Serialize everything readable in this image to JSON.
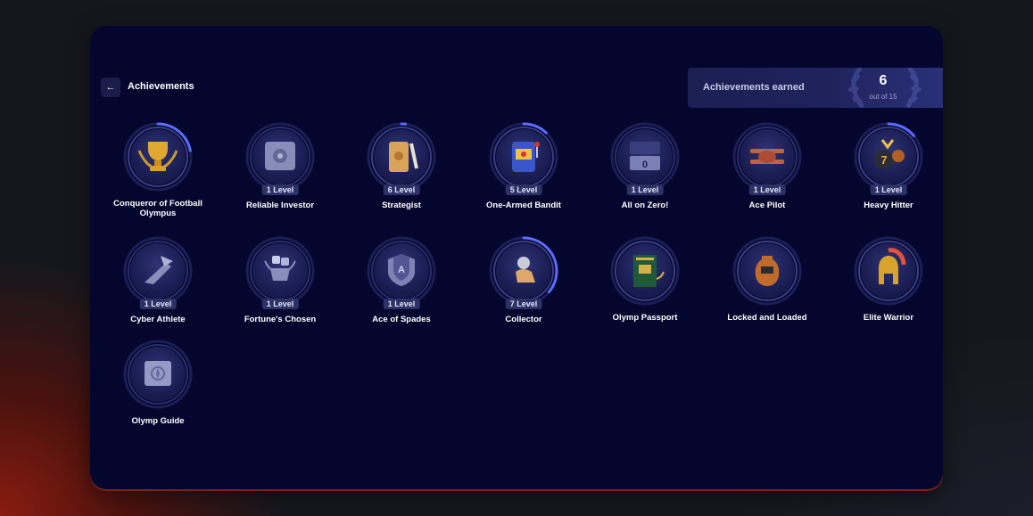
{
  "header": {
    "back_icon": "arrow-left-icon",
    "title": "Achievements"
  },
  "summary": {
    "label": "Achievements earned",
    "count": "6",
    "total": "out of 15",
    "decoration_icon": "laurel-wreath-icon"
  },
  "colors": {
    "panel": "#05062e",
    "progress_ring": "#5c6cff",
    "ring_track": "#1c1f55",
    "level_badge": "#2c3166"
  },
  "achievements": [
    {
      "name": "Conqueror of Football Olympus",
      "level": "",
      "progress": 0.22,
      "icon": "trophy-cup-icon",
      "earned": true
    },
    {
      "name": "Reliable Investor",
      "level": "1 Level",
      "progress": 0.0,
      "icon": "safe-icon",
      "earned": false
    },
    {
      "name": "Strategist",
      "level": "6 Level",
      "progress": 0.02,
      "icon": "scroll-quill-icon",
      "earned": true
    },
    {
      "name": "One-Armed Bandit",
      "level": "5 Level",
      "progress": 0.12,
      "icon": "slot-machine-icon",
      "earned": true
    },
    {
      "name": "All on Zero!",
      "level": "1 Level",
      "progress": 0.0,
      "icon": "calendar-zero-icon",
      "earned": false
    },
    {
      "name": "Ace Pilot",
      "level": "1 Level",
      "progress": 0.0,
      "icon": "biplane-icon",
      "earned": false
    },
    {
      "name": "Heavy Hitter",
      "level": "1 Level",
      "progress": 0.14,
      "icon": "seven-ball-icon",
      "earned": true
    },
    {
      "name": "Cyber Athlete",
      "level": "1 Level",
      "progress": 0.0,
      "icon": "winged-sandal-icon",
      "earned": false
    },
    {
      "name": "Fortune's Chosen",
      "level": "1 Level",
      "progress": 0.0,
      "icon": "cup-dice-icon",
      "earned": false
    },
    {
      "name": "Ace of Spades",
      "level": "1 Level",
      "progress": 0.0,
      "icon": "spade-shield-icon",
      "earned": false
    },
    {
      "name": "Collector",
      "level": "7 Level",
      "progress": 0.36,
      "icon": "hand-coin-icon",
      "earned": true
    },
    {
      "name": "Olymp Passport",
      "level": "",
      "progress": 0.0,
      "icon": "passport-icon",
      "earned": true
    },
    {
      "name": "Locked and Loaded",
      "level": "",
      "progress": 0.0,
      "icon": "amphora-icon",
      "earned": true
    },
    {
      "name": "Elite Warrior",
      "level": "",
      "progress": 0.0,
      "icon": "spartan-helmet-icon",
      "earned": true
    },
    {
      "name": "Olymp Guide",
      "level": "",
      "progress": 0.0,
      "icon": "map-scroll-icon",
      "earned": false
    }
  ]
}
